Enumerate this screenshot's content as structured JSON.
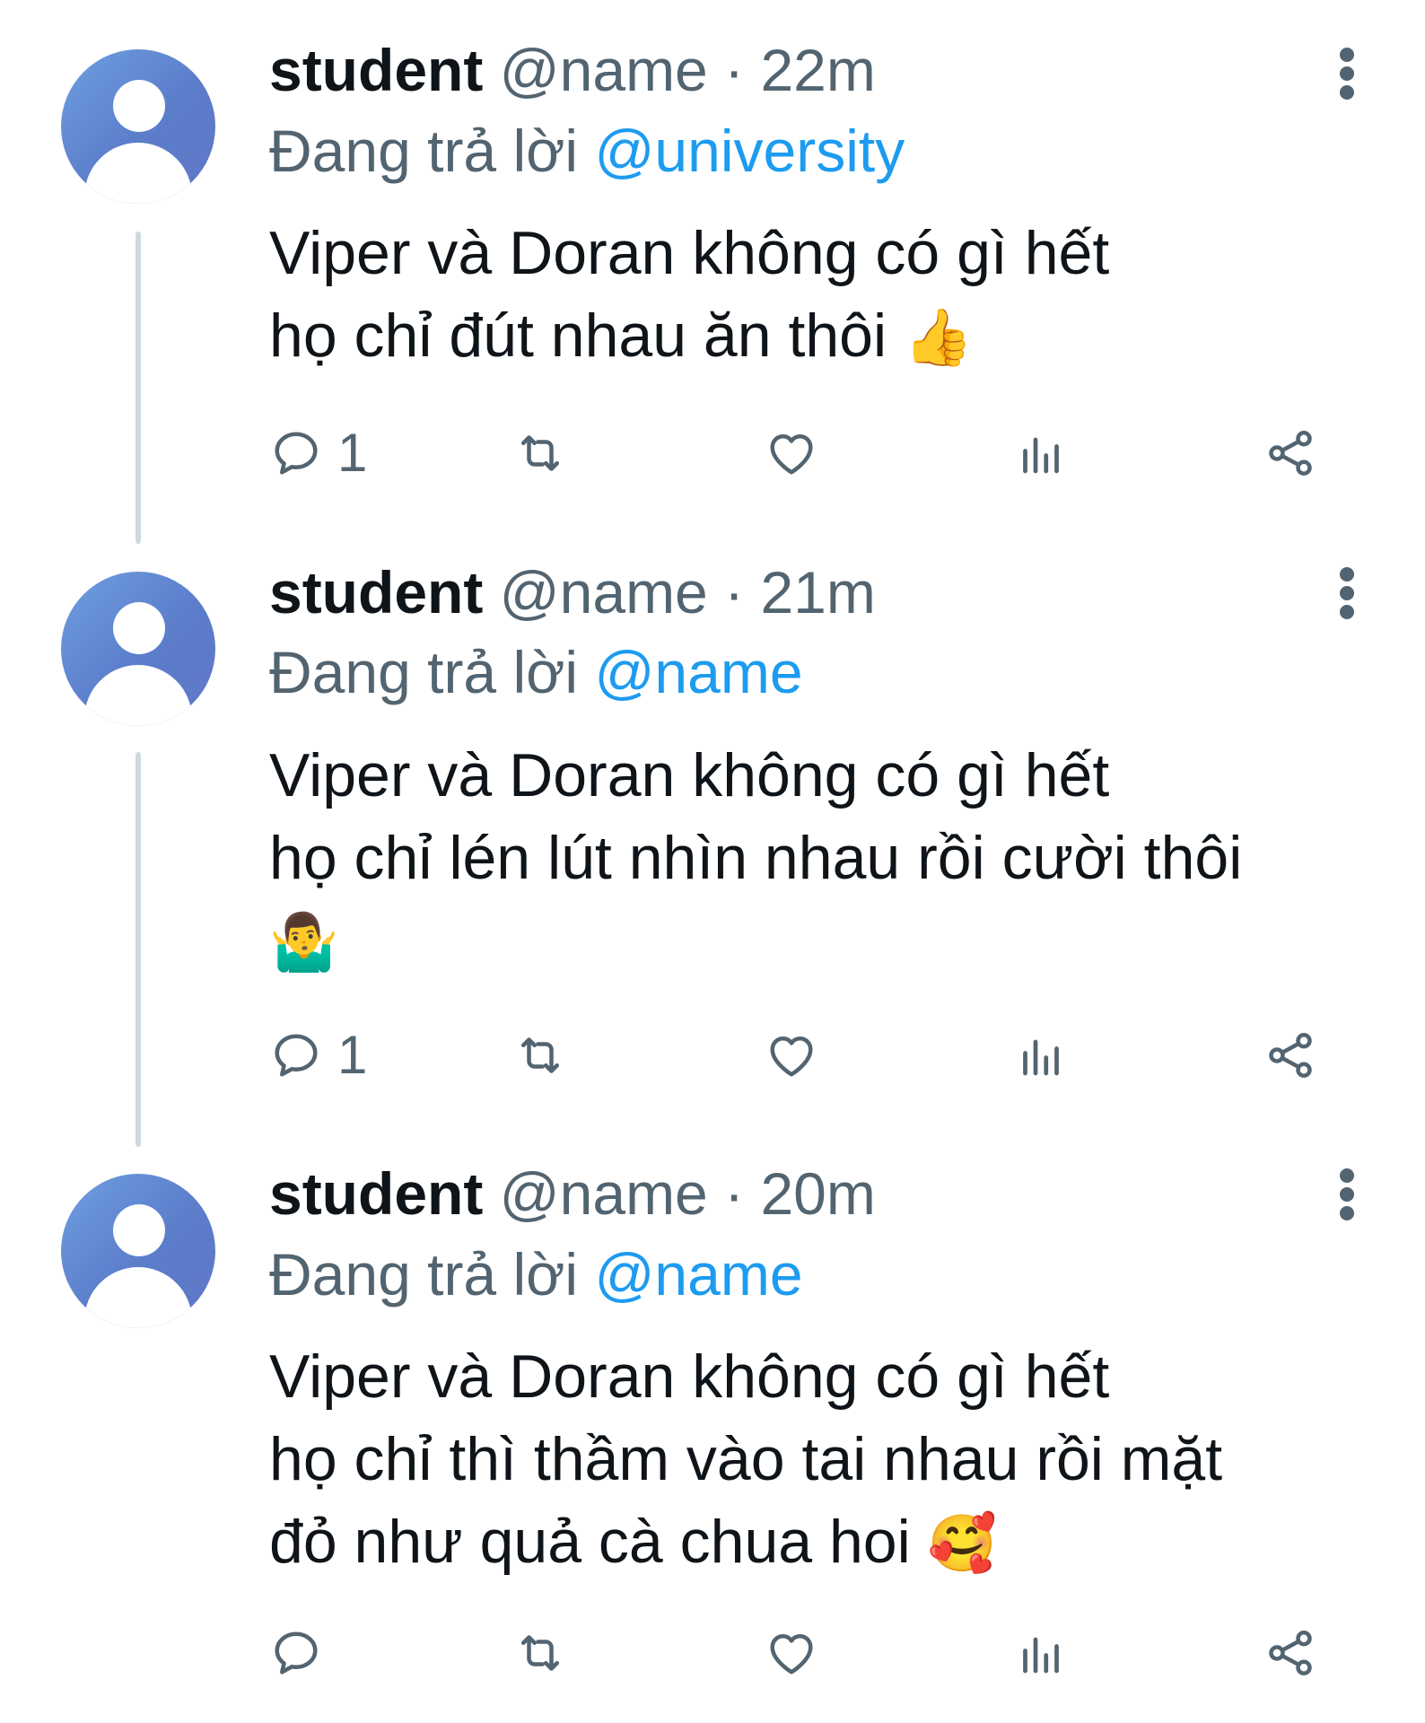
{
  "tweets": [
    {
      "display_name": "student",
      "handle": "@name",
      "separator": "·",
      "time": "22m",
      "reply_prefix": "Đang trả lời",
      "reply_to": "@university",
      "text_lines": [
        "Viper và Doran không có gì hết",
        "họ chỉ đút nhau ăn thôi"
      ],
      "emoji": "👍",
      "reply_count": "1"
    },
    {
      "display_name": "student",
      "handle": "@name",
      "separator": "·",
      "time": "21m",
      "reply_prefix": "Đang trả lời",
      "reply_to": "@name",
      "text_lines": [
        "Viper và Doran không có gì hết",
        "họ chỉ lén lút nhìn nhau rồi cười thôi"
      ],
      "emoji": "🤷‍♂️",
      "reply_count": "1"
    },
    {
      "display_name": "student",
      "handle": "@name",
      "separator": "·",
      "time": "20m",
      "reply_prefix": "Đang trả lời",
      "reply_to": "@name",
      "text_lines": [
        "Viper và Doran không có gì hết",
        "họ chỉ thì thầm vào tai nhau rồi mặt",
        "đỏ như quả cà chua hoi"
      ],
      "emoji": "🥰",
      "reply_count": ""
    }
  ],
  "icons": {
    "reply": "reply-icon",
    "retweet": "retweet-icon",
    "like": "heart-icon",
    "views": "views-icon",
    "share": "share-icon",
    "more": "more-vertical-icon"
  },
  "colors": {
    "text": "#0f1419",
    "secondary": "#536471",
    "mention": "#1d9bf0",
    "thread_line": "#cfd9de"
  }
}
